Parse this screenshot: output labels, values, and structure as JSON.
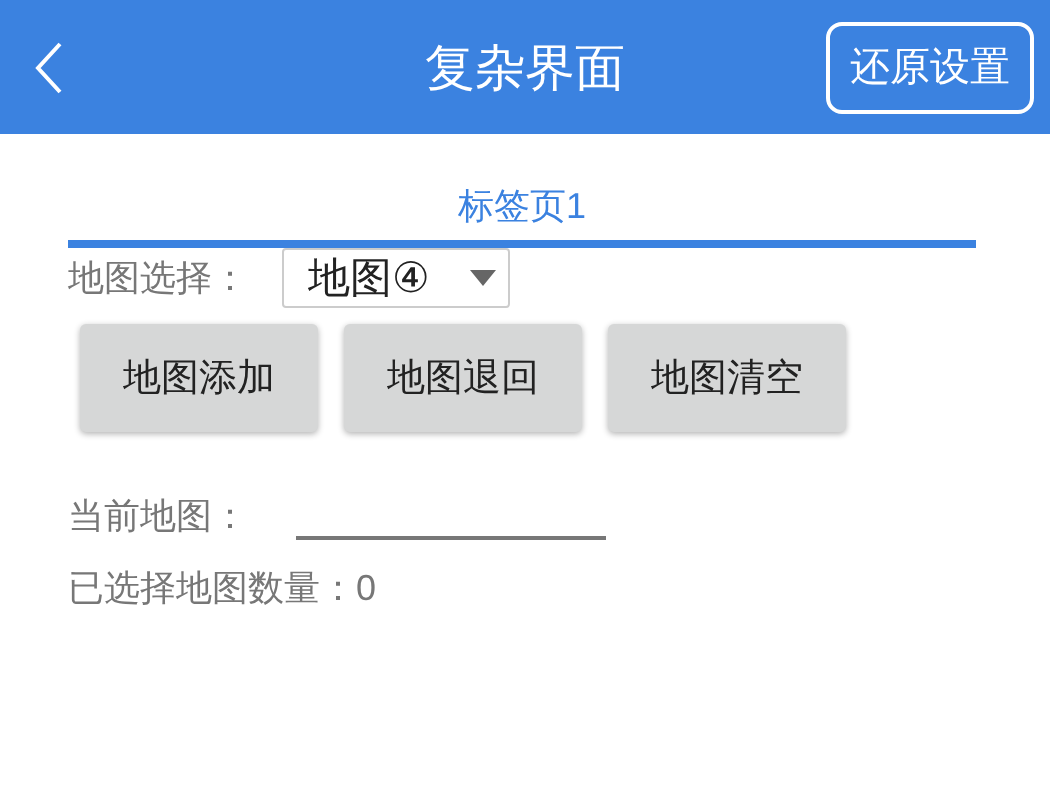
{
  "header": {
    "title": "复杂界面",
    "action_button": "还原设置"
  },
  "tabs": [
    {
      "label": "标签页1",
      "selected": true
    }
  ],
  "map_select": {
    "label": "地图选择：",
    "value": "地图④"
  },
  "buttons": [
    "地图添加",
    "地图退回",
    "地图清空"
  ],
  "current_map": {
    "label": "当前地图："
  },
  "count": {
    "label": "已选择地图数量：",
    "value": "0"
  }
}
